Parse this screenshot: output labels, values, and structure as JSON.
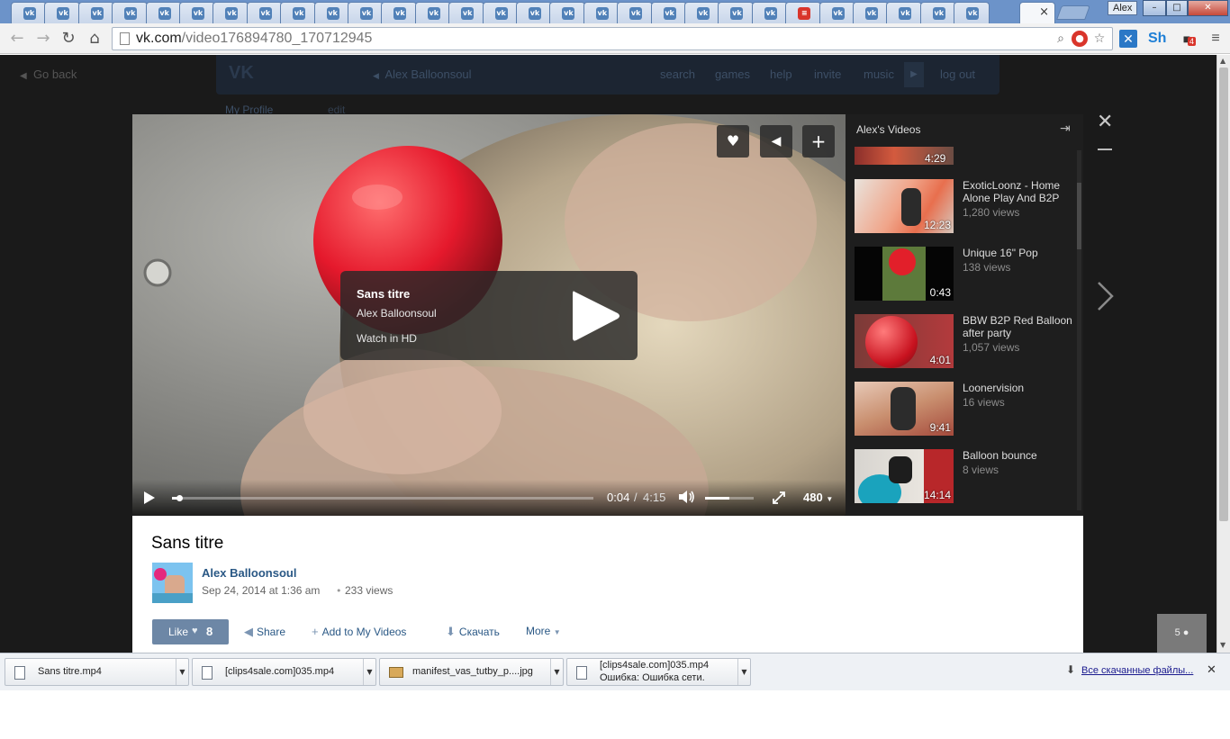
{
  "browser": {
    "tab_count": 30,
    "active_tab_close": "×",
    "user_name": "Alex",
    "url_host": "vk.com",
    "url_path": "/video176894780_170712945",
    "ext_label_sh": "Sh",
    "ext_badge": "4"
  },
  "page": {
    "go_back": "Go back",
    "header": {
      "user": "Alex Balloonsoul",
      "links": [
        "search",
        "games",
        "help",
        "invite",
        "music",
        "log out"
      ]
    },
    "sidebar_menu": {
      "my_profile": "My Profile",
      "edit": "edit"
    }
  },
  "player": {
    "overlay_title": "Sans titre",
    "overlay_author": "Alex Balloonsoul",
    "overlay_hd": "Watch in HD",
    "time_current": "0:04",
    "time_sep": "/",
    "time_total": "4:15",
    "progress_fraction": 0.016,
    "volume_fraction": 0.5,
    "quality": "480",
    "icons": [
      "heart-icon",
      "megaphone-icon",
      "plus-icon"
    ]
  },
  "sidebar": {
    "title": "Alex's Videos",
    "videos": [
      {
        "title": "",
        "views": "",
        "duration": "4:29"
      },
      {
        "title": "ExoticLoonz - Home Alone Play And B2P",
        "views": "1,280 views",
        "duration": "12:23"
      },
      {
        "title": "Unique 16\" Pop",
        "views": "138 views",
        "duration": "0:43"
      },
      {
        "title": "BBW B2P Red Balloon after party",
        "views": "1,057 views",
        "duration": "4:01"
      },
      {
        "title": "Loonervision",
        "views": "16 views",
        "duration": "9:41"
      },
      {
        "title": "Balloon bounce",
        "views": "8 views",
        "duration": "14:14"
      }
    ]
  },
  "video_info": {
    "title": "Sans titre",
    "author": "Alex Balloonsoul",
    "date": "Sep 24, 2014 at 1:36 am",
    "views": "233 views",
    "like_label": "Like",
    "like_count": "8",
    "share": "Share",
    "add": "Add to My Videos",
    "download": "Скачать",
    "more": "More"
  },
  "chat_widget": "5",
  "downloads": {
    "items": [
      {
        "name": "Sans titre.mp4",
        "status": ""
      },
      {
        "name": "[clips4sale.com]035.mp4",
        "status": ""
      },
      {
        "name": "manifest_vas_tutby_p....jpg",
        "status": ""
      },
      {
        "name": "[clips4sale.com]035.mp4",
        "status": "Ошибка: Ошибка сети."
      }
    ],
    "show_all": "Все скачанные файлы..."
  },
  "colors": {
    "vk_blue": "#2a5885",
    "like_button": "#6d87a6",
    "tab_strip": "#6c93c9"
  }
}
